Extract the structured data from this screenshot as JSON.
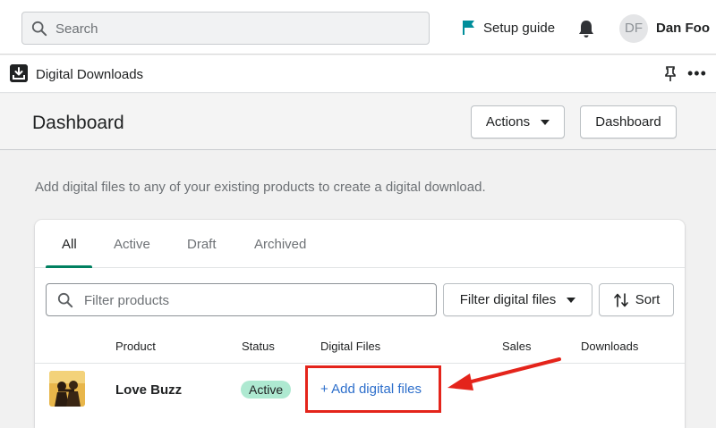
{
  "topbar": {
    "search_placeholder": "Search",
    "setup_guide": "Setup guide",
    "avatar_initials": "DF",
    "user_name": "Dan Foo"
  },
  "app": {
    "name": "Digital Downloads",
    "more": "•••"
  },
  "page": {
    "title": "Dashboard",
    "actions_button": "Actions",
    "dashboard_button": "Dashboard",
    "intro": "Add digital files to any of your existing products to create a digital download."
  },
  "tabs": [
    "All",
    "Active",
    "Draft",
    "Archived"
  ],
  "filters": {
    "search_placeholder": "Filter products",
    "filter_files": "Filter digital files",
    "sort": "Sort"
  },
  "table": {
    "headers": [
      "Product",
      "Status",
      "Digital Files",
      "Sales",
      "Downloads"
    ],
    "rows": [
      {
        "product": "Love Buzz",
        "status": "Active",
        "digital_files": "+ Add digital files"
      }
    ]
  },
  "colors": {
    "accent_green": "#008060",
    "badge_green": "#aee9d1",
    "link_blue": "#2c6ecb",
    "annotation_red": "#e4241b",
    "flag_teal": "#008E9B"
  },
  "icons": {
    "search": "search-icon",
    "flag": "flag-icon",
    "bell": "bell-icon",
    "pin": "pin-icon",
    "sort": "sort-icon"
  }
}
